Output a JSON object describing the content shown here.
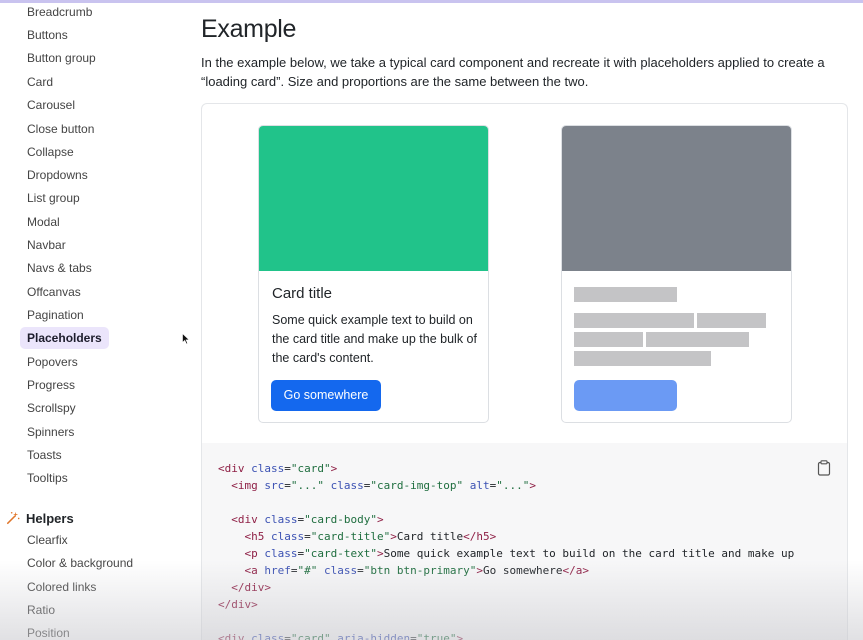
{
  "sidebar": {
    "items": [
      {
        "label": "Breadcrumb",
        "active": false
      },
      {
        "label": "Buttons",
        "active": false
      },
      {
        "label": "Button group",
        "active": false
      },
      {
        "label": "Card",
        "active": false
      },
      {
        "label": "Carousel",
        "active": false
      },
      {
        "label": "Close button",
        "active": false
      },
      {
        "label": "Collapse",
        "active": false
      },
      {
        "label": "Dropdowns",
        "active": false
      },
      {
        "label": "List group",
        "active": false
      },
      {
        "label": "Modal",
        "active": false
      },
      {
        "label": "Navbar",
        "active": false
      },
      {
        "label": "Navs & tabs",
        "active": false
      },
      {
        "label": "Offcanvas",
        "active": false
      },
      {
        "label": "Pagination",
        "active": false
      },
      {
        "label": "Placeholders",
        "active": true
      },
      {
        "label": "Popovers",
        "active": false
      },
      {
        "label": "Progress",
        "active": false
      },
      {
        "label": "Scrollspy",
        "active": false
      },
      {
        "label": "Spinners",
        "active": false
      },
      {
        "label": "Toasts",
        "active": false
      },
      {
        "label": "Tooltips",
        "active": false
      }
    ],
    "helpers_heading": "Helpers",
    "helpers_icon": "magic-wand-icon",
    "helper_items": [
      {
        "label": "Clearfix"
      },
      {
        "label": "Color & background"
      },
      {
        "label": "Colored links"
      },
      {
        "label": "Ratio"
      },
      {
        "label": "Position"
      }
    ]
  },
  "main": {
    "title": "Example",
    "intro": "In the example below, we take a typical card component and recreate it with placeholders applied to create a “loading card”. Size and proportions are the same between the two.",
    "card": {
      "title": "Card title",
      "text": "Some quick example text to build on the card title and make up the bulk of the card's content.",
      "button": "Go somewhere",
      "image_color": "#21c38a",
      "button_color": "#1468ee"
    },
    "placeholder_card": {
      "image_color": "#7c828b",
      "bar_color": "#c4c4c6",
      "button_color": "#6b9af4"
    },
    "code_lines": [
      [
        {
          "t": "p",
          "v": "<div "
        },
        {
          "t": "a",
          "v": "class"
        },
        {
          "t": "p",
          "v": "="
        },
        {
          "t": "s",
          "v": "\"card\""
        },
        {
          "t": "p",
          "v": ">"
        }
      ],
      [
        {
          "t": "p",
          "v": "  <img "
        },
        {
          "t": "a",
          "v": "src"
        },
        {
          "t": "p",
          "v": "="
        },
        {
          "t": "s",
          "v": "\"...\""
        },
        {
          "t": "p",
          "v": " "
        },
        {
          "t": "a",
          "v": "class"
        },
        {
          "t": "p",
          "v": "="
        },
        {
          "t": "s",
          "v": "\"card-img-top\""
        },
        {
          "t": "p",
          "v": " "
        },
        {
          "t": "a",
          "v": "alt"
        },
        {
          "t": "p",
          "v": "="
        },
        {
          "t": "s",
          "v": "\"...\""
        },
        {
          "t": "p",
          "v": ">"
        }
      ],
      [
        {
          "t": "p",
          "v": ""
        }
      ],
      [
        {
          "t": "p",
          "v": "  <div "
        },
        {
          "t": "a",
          "v": "class"
        },
        {
          "t": "p",
          "v": "="
        },
        {
          "t": "s",
          "v": "\"card-body\""
        },
        {
          "t": "p",
          "v": ">"
        }
      ],
      [
        {
          "t": "p",
          "v": "    <h5 "
        },
        {
          "t": "a",
          "v": "class"
        },
        {
          "t": "p",
          "v": "="
        },
        {
          "t": "s",
          "v": "\"card-title\""
        },
        {
          "t": "p",
          "v": ">Card title</h5>"
        }
      ],
      [
        {
          "t": "p",
          "v": "    <p "
        },
        {
          "t": "a",
          "v": "class"
        },
        {
          "t": "p",
          "v": "="
        },
        {
          "t": "s",
          "v": "\"card-text\""
        },
        {
          "t": "p",
          "v": ">Some quick example text to build on the card title and make up"
        }
      ],
      [
        {
          "t": "p",
          "v": "    <a "
        },
        {
          "t": "a",
          "v": "href"
        },
        {
          "t": "p",
          "v": "="
        },
        {
          "t": "s",
          "v": "\"#\""
        },
        {
          "t": "p",
          "v": " "
        },
        {
          "t": "a",
          "v": "class"
        },
        {
          "t": "p",
          "v": "="
        },
        {
          "t": "s",
          "v": "\"btn btn-primary\""
        },
        {
          "t": "p",
          "v": ">Go somewhere</a>"
        }
      ],
      [
        {
          "t": "p",
          "v": "  </div>"
        }
      ],
      [
        {
          "t": "p",
          "v": "</div>"
        }
      ],
      [
        {
          "t": "p",
          "v": ""
        }
      ],
      [
        {
          "t": "p",
          "v": "<div "
        },
        {
          "t": "a",
          "v": "class"
        },
        {
          "t": "p",
          "v": "="
        },
        {
          "t": "s",
          "v": "\"card\""
        },
        {
          "t": "p",
          "v": " "
        },
        {
          "t": "a",
          "v": "aria-hidden"
        },
        {
          "t": "p",
          "v": "="
        },
        {
          "t": "s",
          "v": "\"true\""
        },
        {
          "t": "p",
          "v": ">"
        }
      ]
    ],
    "copy_icon": "clipboard-icon"
  }
}
